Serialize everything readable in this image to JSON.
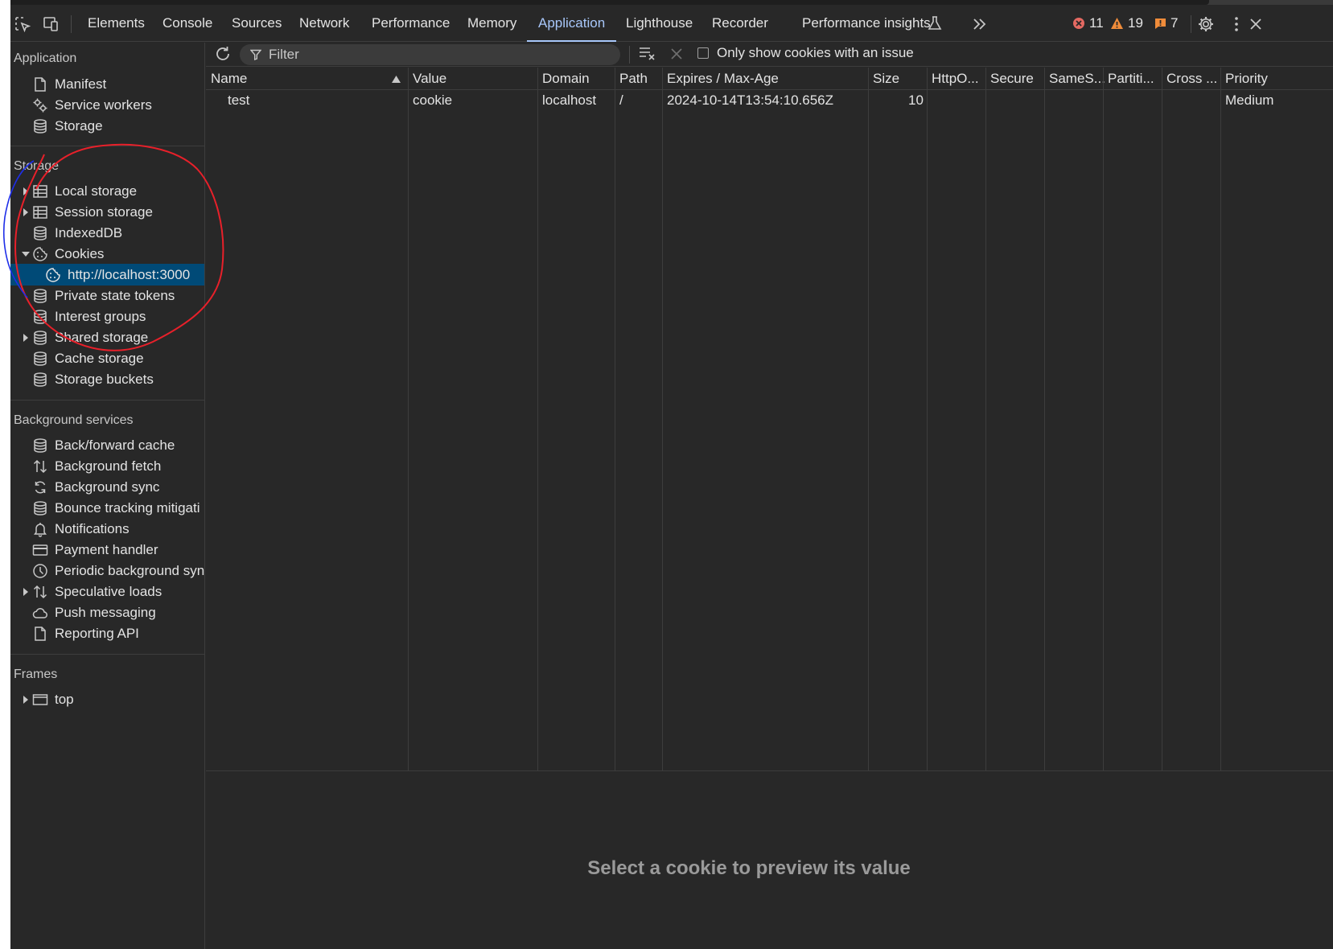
{
  "toolbar": {
    "tabs": [
      {
        "label": "Elements"
      },
      {
        "label": "Console"
      },
      {
        "label": "Sources"
      },
      {
        "label": "Network"
      },
      {
        "label": "Performance"
      },
      {
        "label": "Memory"
      },
      {
        "label": "Application"
      },
      {
        "label": "Lighthouse"
      },
      {
        "label": "Recorder"
      },
      {
        "label": "Performance insights"
      }
    ],
    "active_tab": "Application",
    "errors_count": "11",
    "warnings_count": "19",
    "issues_count": "7",
    "icons": [
      "inspect-element-icon",
      "device-toolbar-icon",
      "flask-icon",
      "more-tabs-icon",
      "error-icon",
      "warning-icon",
      "issue-icon",
      "settings-icon",
      "more-options-icon",
      "close-icon"
    ]
  },
  "sidebar": {
    "application": {
      "title": "Application",
      "items": [
        {
          "label": "Manifest",
          "icon": "file-icon"
        },
        {
          "label": "Service workers",
          "icon": "gears-icon"
        },
        {
          "label": "Storage",
          "icon": "database-icon"
        }
      ]
    },
    "storage": {
      "title": "Storage",
      "items": [
        {
          "label": "Local storage",
          "icon": "table-icon"
        },
        {
          "label": "Session storage",
          "icon": "table-icon"
        },
        {
          "label": "IndexedDB",
          "icon": "database-icon"
        },
        {
          "label": "Cookies",
          "icon": "cookie-icon"
        },
        {
          "label": "http://localhost:3000",
          "icon": "cookie-icon"
        },
        {
          "label": "Private state tokens",
          "icon": "database-icon"
        },
        {
          "label": "Interest groups",
          "icon": "database-icon"
        },
        {
          "label": "Shared storage",
          "icon": "database-icon"
        },
        {
          "label": "Cache storage",
          "icon": "database-icon"
        },
        {
          "label": "Storage buckets",
          "icon": "database-icon"
        }
      ]
    },
    "background": {
      "title": "Background services",
      "items": [
        {
          "label": "Back/forward cache",
          "icon": "database-icon"
        },
        {
          "label": "Background fetch",
          "icon": "arrows-updown-icon"
        },
        {
          "label": "Background sync",
          "icon": "sync-icon"
        },
        {
          "label": "Bounce tracking mitigati",
          "icon": "database-icon"
        },
        {
          "label": "Notifications",
          "icon": "bell-icon"
        },
        {
          "label": "Payment handler",
          "icon": "card-icon"
        },
        {
          "label": "Periodic background syn",
          "icon": "clock-icon"
        },
        {
          "label": "Speculative loads",
          "icon": "arrows-updown-icon"
        },
        {
          "label": "Push messaging",
          "icon": "cloud-icon"
        },
        {
          "label": "Reporting API",
          "icon": "file-icon"
        }
      ]
    },
    "frames": {
      "title": "Frames",
      "items": [
        {
          "label": "top",
          "icon": "frame-icon"
        }
      ]
    }
  },
  "cookies": {
    "filter_placeholder": "Filter",
    "only_issue_label": "Only show cookies with an issue",
    "only_issue_checked": false,
    "columns": [
      "Name",
      "Value",
      "Domain",
      "Path",
      "Expires / Max-Age",
      "Size",
      "HttpO...",
      "Secure",
      "SameS...",
      "Partiti...",
      "Cross ...",
      "Priority"
    ],
    "sorted_column": "Name",
    "rows": [
      {
        "name": "test",
        "value": "cookie",
        "domain": "localhost",
        "path": "/",
        "expires": "2024-10-14T13:54:10.656Z",
        "size": "10",
        "priority": "Medium"
      }
    ],
    "preview_message": "Select a cookie to preview its value"
  },
  "colors": {
    "background": "#282828",
    "accent": "#a8c7fa",
    "selected_row": "#004a77",
    "error": "#e46962",
    "warning": "#f08c3a",
    "annotation_red": "#e8202a",
    "annotation_blue": "#1e2ee8"
  }
}
